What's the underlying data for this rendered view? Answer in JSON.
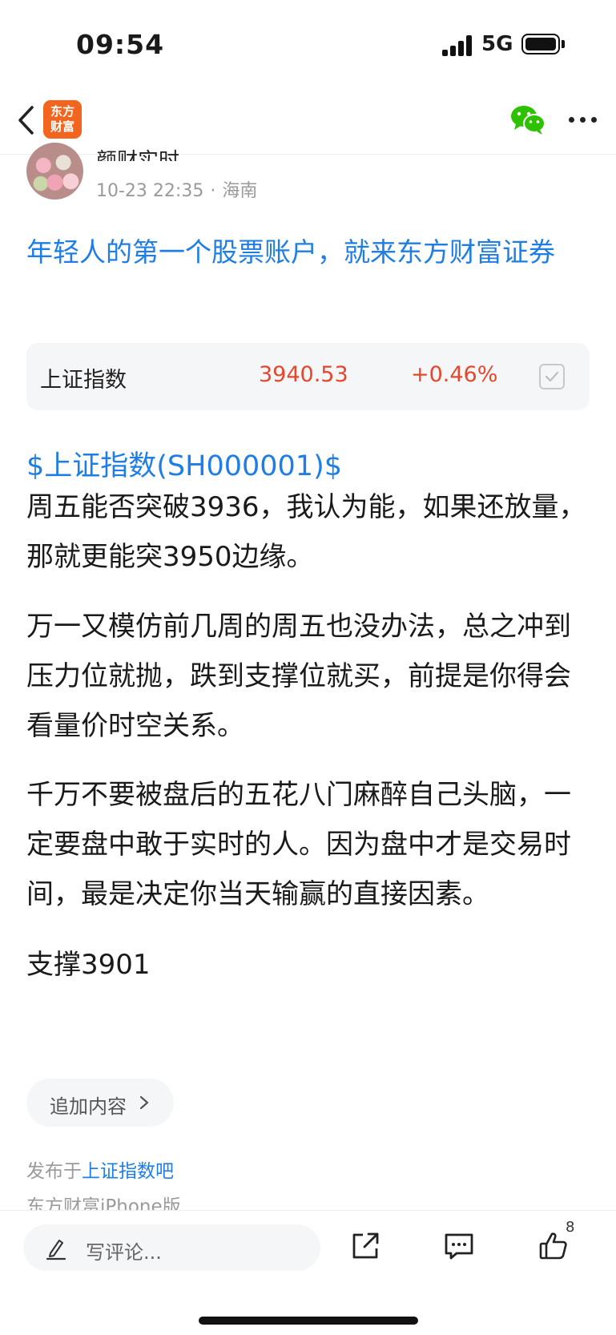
{
  "status_bar": {
    "time": "09:54",
    "network": "5G"
  },
  "nav": {
    "logo_line1": "东方",
    "logo_line2": "财富"
  },
  "author": {
    "name": "颜财实时",
    "date": "10-23 22:35",
    "separator": "·",
    "location": "海南"
  },
  "ad_link": "年轻人的第一个股票账户，就来东方财富证券",
  "stock_card": {
    "name": "上证指数",
    "price": "3940.53",
    "change": "+0.46%"
  },
  "stock_tag": "$上证指数(SH000001)$",
  "paragraphs": [
    "周五能否突破3936，我认为能，如果还放量，那就更能突3950边缘。",
    "万一又模仿前几周的周五也没办法，总之冲到压力位就抛，跌到支撑位就买，前提是你得会看量价时空关系。",
    "千万不要被盘后的五花八门麻醉自己头脑，一定要盘中敢于实时的人。因为盘中才是交易时间，最是决定你当天输赢的直接因素。",
    "支撑3901"
  ],
  "append_button": "追加内容",
  "published": {
    "prefix": "发布于",
    "forum": "上证指数吧"
  },
  "source": "东方财富iPhone版",
  "bottom_bar": {
    "comment_placeholder": "写评论...",
    "like_count": "8"
  },
  "colors": {
    "link_blue": "#1f7ee6",
    "up_red": "#e8462b",
    "brand_orange": "#f2651e",
    "wechat_green": "#2dc100"
  }
}
